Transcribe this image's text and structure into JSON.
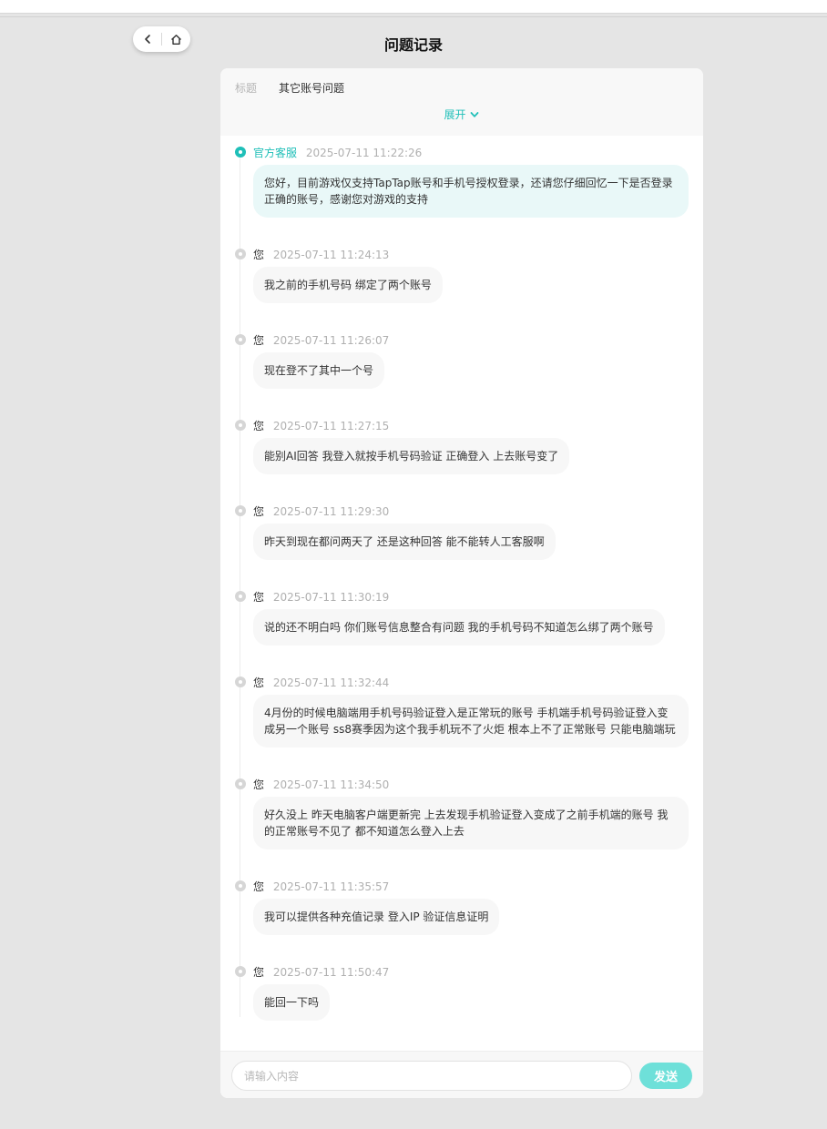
{
  "nav": {
    "back_icon": "chevron-left-icon",
    "home_icon": "home-icon"
  },
  "page": {
    "title": "问题记录"
  },
  "header": {
    "title_label": "标题",
    "title_value": "其它账号问题",
    "expand_label": "展开"
  },
  "messages": [
    {
      "sender": "官方客服",
      "time": "2025-07-11 11:22:26",
      "text": "您好，目前游戏仅支持TapTap账号和手机号授权登录，还请您仔细回忆一下是否登录正确的账号，感谢您对游戏的支持"
    },
    {
      "sender": "您",
      "time": "2025-07-11 11:24:13",
      "text": "我之前的手机号码 绑定了两个账号"
    },
    {
      "sender": "您",
      "time": "2025-07-11 11:26:07",
      "text": "现在登不了其中一个号"
    },
    {
      "sender": "您",
      "time": "2025-07-11 11:27:15",
      "text": "能别AI回答 我登入就按手机号码验证 正确登入 上去账号变了"
    },
    {
      "sender": "您",
      "time": "2025-07-11 11:29:30",
      "text": "昨天到现在都问两天了 还是这种回答 能不能转人工客服啊"
    },
    {
      "sender": "您",
      "time": "2025-07-11 11:30:19",
      "text": "说的还不明白吗 你们账号信息整合有问题 我的手机号码不知道怎么绑了两个账号"
    },
    {
      "sender": "您",
      "time": "2025-07-11 11:32:44",
      "text": "4月份的时候电脑端用手机号码验证登入是正常玩的账号 手机端手机号码验证登入变成另一个账号 ss8赛季因为这个我手机玩不了火炬 根本上不了正常账号 只能电脑端玩"
    },
    {
      "sender": "您",
      "time": "2025-07-11 11:34:50",
      "text": "好久没上 昨天电脑客户端更新完 上去发现手机验证登入变成了之前手机端的账号 我的正常账号不见了 都不知道怎么登入上去"
    },
    {
      "sender": "您",
      "time": "2025-07-11 11:35:57",
      "text": "我可以提供各种充值记录 登入IP 验证信息证明"
    },
    {
      "sender": "您",
      "time": "2025-07-11 11:50:47",
      "text": "能回一下吗"
    }
  ],
  "composer": {
    "placeholder": "请输入内容",
    "send_label": "发送"
  },
  "colors": {
    "accent": "#1fbfb8",
    "send_button": "#6ee0d9",
    "background": "#e5e5e5"
  }
}
